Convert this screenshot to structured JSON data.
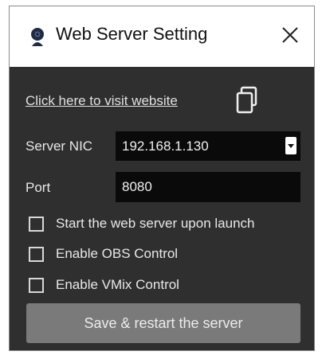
{
  "window": {
    "title": "Web Server Setting",
    "app_icon": "webcam-icon",
    "close_icon": "close-icon"
  },
  "link": {
    "text": "Click here to visit website",
    "copy_icon": "copy-icon"
  },
  "server_nic": {
    "label": "Server NIC",
    "value": "192.168.1.130",
    "dropdown_icon": "chevron-down-icon"
  },
  "port": {
    "label": "Port",
    "value": "8080"
  },
  "options": [
    {
      "label": "Start the web server upon launch",
      "checked": false
    },
    {
      "label": "Enable OBS Control",
      "checked": false
    },
    {
      "label": "Enable VMix Control",
      "checked": false
    }
  ],
  "save_button": {
    "label": "Save & restart the server"
  },
  "colors": {
    "background": "#2f2f2f",
    "titlebar": "#ffffff",
    "field": "#0a0a0a",
    "button": "#7a7a7a"
  }
}
